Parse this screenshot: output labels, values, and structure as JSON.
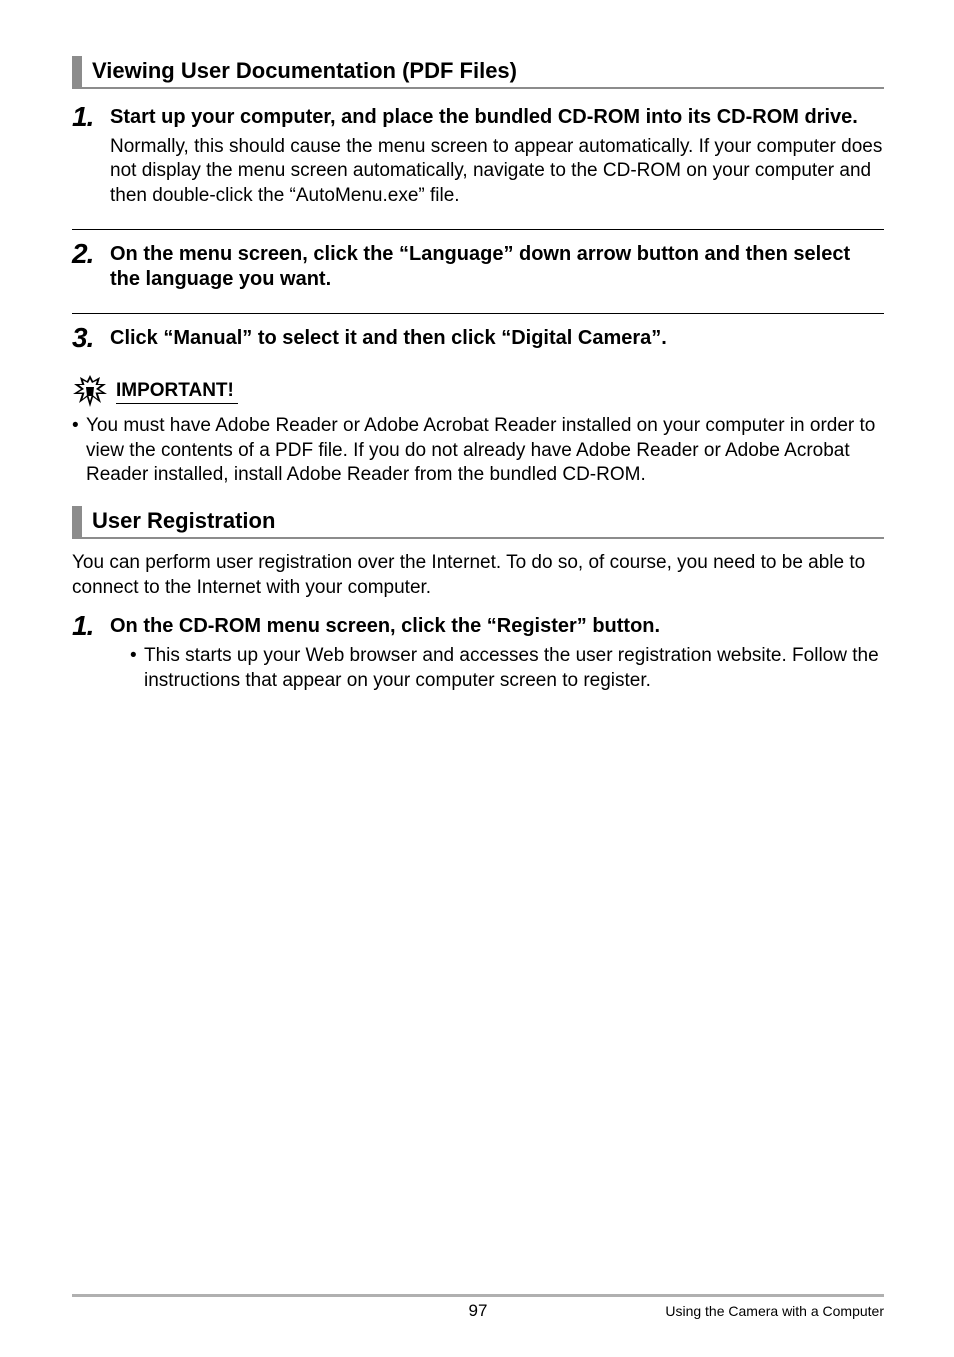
{
  "section1": {
    "title": "Viewing User Documentation (PDF Files)",
    "steps": [
      {
        "num": "1.",
        "title": "Start up your computer, and place the bundled CD-ROM into its CD-ROM drive.",
        "desc": "Normally, this should cause the menu screen to appear automatically. If your computer does not display the menu screen automatically, navigate to the CD-ROM on your computer and then double-click the “AutoMenu.exe” file."
      },
      {
        "num": "2.",
        "title": "On the menu screen, click the “Language” down arrow button and then select the language you want."
      },
      {
        "num": "3.",
        "title": "Click “Manual” to select it and then click “Digital Camera”."
      }
    ],
    "important": {
      "label": "IMPORTANT!",
      "text": "You must have Adobe Reader or Adobe Acrobat Reader installed on your computer in order to view the contents of a PDF file. If you do not already have Adobe Reader or Adobe Acrobat Reader installed, install Adobe Reader from the bundled CD-ROM."
    }
  },
  "section2": {
    "title": "User Registration",
    "intro": "You can perform user registration over the Internet. To do so, of course, you need to be able to connect to the Internet with your computer.",
    "steps": [
      {
        "num": "1.",
        "title": "On the CD-ROM menu screen, click the “Register” button.",
        "sub": "This starts up your Web browser and accesses the user registration website. Follow the instructions that appear on your computer screen to register."
      }
    ]
  },
  "footer": {
    "page": "97",
    "right": "Using the Camera with a Computer"
  }
}
